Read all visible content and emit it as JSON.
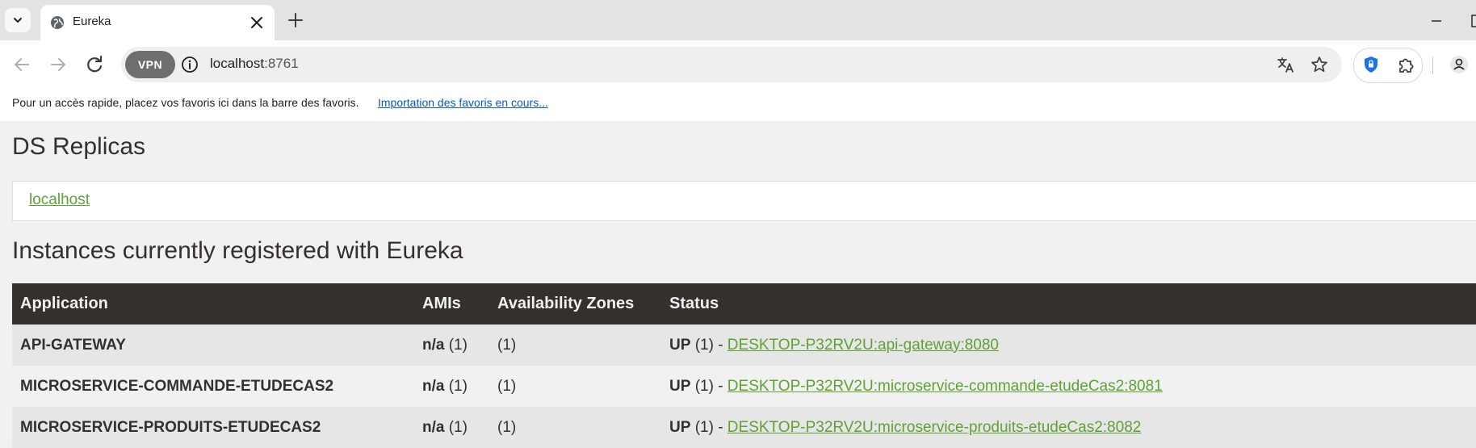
{
  "browser": {
    "tab_title": "Eureka",
    "address": {
      "host": "localhost",
      "port": ":8761"
    },
    "vpn_label": "VPN",
    "bookmarks_bar": {
      "hint": "Pour un accès rapide, placez vos favoris ici dans la barre des favoris.",
      "import_link": "Importation des favoris en cours..."
    },
    "icons": [
      "tab-search-icon",
      "globe-icon",
      "close-icon",
      "plus-icon",
      "minimize-icon",
      "back-icon",
      "forward-icon",
      "reload-icon",
      "info-icon",
      "translate-icon",
      "star-icon",
      "shield-icon",
      "puzzle-icon",
      "profile-icon"
    ]
  },
  "page": {
    "replicas_heading": "DS Replicas",
    "replicas": [
      "localhost"
    ],
    "instances_heading": "Instances currently registered with Eureka",
    "table": {
      "headers": [
        "Application",
        "AMIs",
        "Availability Zones",
        "Status"
      ],
      "rows": [
        {
          "application": "API-GATEWAY",
          "amis_value": "n/a",
          "amis_count": "(1)",
          "zones": "(1)",
          "status": "UP",
          "status_count": "(1) -",
          "instance": "DESKTOP-P32RV2U:api-gateway:8080"
        },
        {
          "application": "MICROSERVICE-COMMANDE-ETUDECAS2",
          "amis_value": "n/a",
          "amis_count": "(1)",
          "zones": "(1)",
          "status": "UP",
          "status_count": "(1) -",
          "instance": "DESKTOP-P32RV2U:microservice-commande-etudeCas2:8081"
        },
        {
          "application": "MICROSERVICE-PRODUITS-ETUDECAS2",
          "amis_value": "n/a",
          "amis_count": "(1)",
          "zones": "(1)",
          "status": "UP",
          "status_count": "(1) -",
          "instance": "DESKTOP-P32RV2U:microservice-produits-etudeCas2:8082"
        }
      ]
    }
  },
  "colors": {
    "header_bg": "#34302d",
    "link_green": "#5fa134",
    "page_bg": "#f1f1f1",
    "row_alt": "#e6e6e6"
  }
}
